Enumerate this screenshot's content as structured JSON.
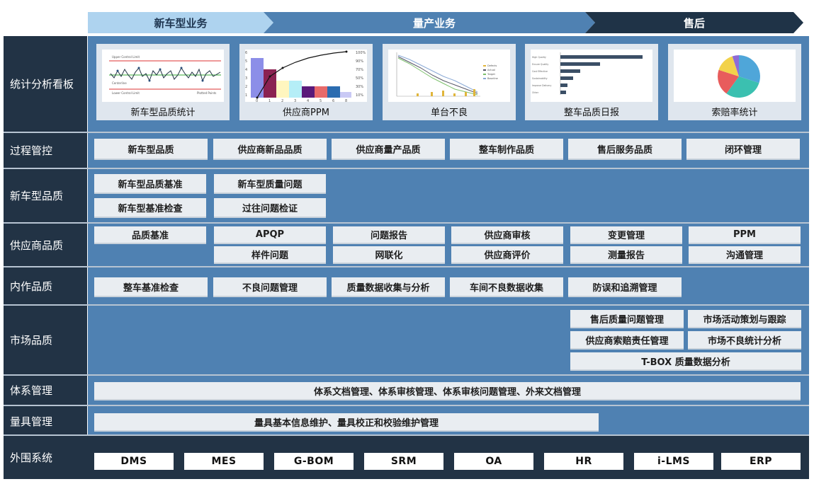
{
  "header": {
    "phase1": "新车型业务",
    "phase2": "量产业务",
    "phase3": "售后"
  },
  "rows": {
    "stats": "统计分析看板",
    "process": "过程管控",
    "newmodel": "新车型品质",
    "supplier": "供应商品质",
    "internal": "内作品质",
    "market": "市场品质",
    "system": "体系管理",
    "gauge": "量具管理",
    "external": "外围系统"
  },
  "dashboard": [
    {
      "title": "新车型品质统计"
    },
    {
      "title": "供应商PPM"
    },
    {
      "title": "单台不良"
    },
    {
      "title": "整车品质日报"
    },
    {
      "title": "索赔率统计"
    }
  ],
  "process_items": [
    "新车型品质",
    "供应商新品品质",
    "供应商量产品质",
    "整车制作品质",
    "售后服务品质",
    "闭环管理"
  ],
  "newmodel_items": [
    "新车型品质基准",
    "新车型质量问题",
    "新车型基准检查",
    "过往问题检证"
  ],
  "supplier_items": [
    "品质基准",
    "APQP",
    "问题报告",
    "供应商审核",
    "变更管理",
    "PPM",
    "样件问题",
    "网联化",
    "供应商评价",
    "测量报告",
    "沟通管理"
  ],
  "internal_items": [
    "整车基准检查",
    "不良问题管理",
    "质量数据收集与分析",
    "车间不良数据收集",
    "防误和追溯管理"
  ],
  "market_items": [
    "售后质量问题管理",
    "市场活动策划与跟踪",
    "供应商索赔责任管理",
    "市场不良统计分析",
    "T-BOX 质量数据分析"
  ],
  "system_text": "体系文档管理、体系审核管理、体系审核问题管理、外来文档管理",
  "gauge_text": "量具基本信息维护、量具校正和校验维护管理",
  "external_items": [
    "DMS",
    "MES",
    "G-BOM",
    "SRM",
    "OA",
    "HR",
    "i-LMS",
    "ERP"
  ],
  "colors": {
    "phase1": "#aed3ef",
    "phase2": "#4f81b2",
    "phase3": "#1f3347",
    "panel": "#4f81b2",
    "label_column": "#223345"
  }
}
